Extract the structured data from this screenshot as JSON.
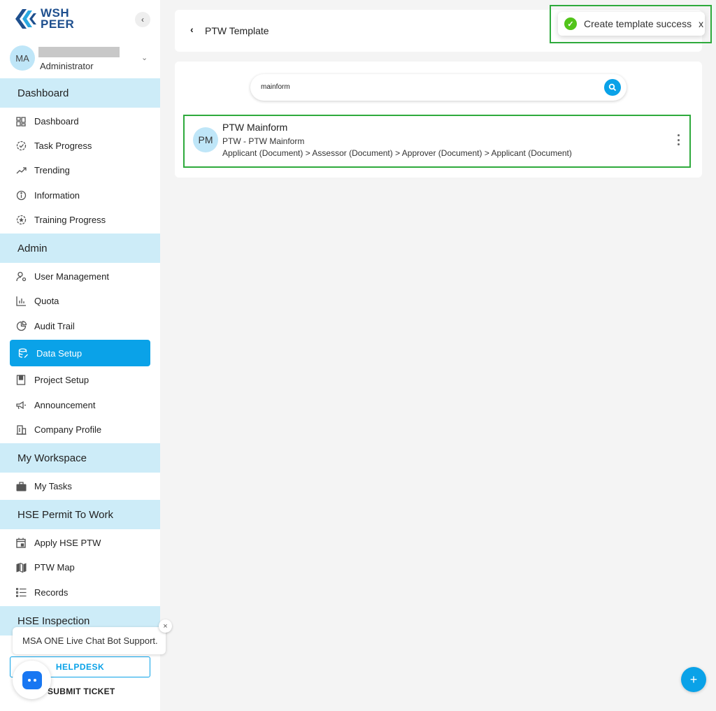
{
  "brand": {
    "line1": "WSH",
    "line2": "PEER",
    "color": "#1e4f8e"
  },
  "user": {
    "initials": "MA",
    "role": "Administrator"
  },
  "sidebar": {
    "sections": [
      {
        "title": "Dashboard",
        "items": [
          {
            "label": "Dashboard",
            "icon": "dashboard-grid-icon"
          },
          {
            "label": "Task Progress",
            "icon": "progress-circle-icon"
          },
          {
            "label": "Trending",
            "icon": "trending-icon"
          },
          {
            "label": "Information",
            "icon": "info-icon"
          },
          {
            "label": "Training Progress",
            "icon": "training-icon"
          }
        ]
      },
      {
        "title": "Admin",
        "items": [
          {
            "label": "User Management",
            "icon": "user-gear-icon"
          },
          {
            "label": "Quota",
            "icon": "bar-chart-icon"
          },
          {
            "label": "Audit Trail",
            "icon": "pie-chart-icon"
          },
          {
            "label": "Data Setup",
            "icon": "database-edit-icon",
            "active": true
          },
          {
            "label": "Project Setup",
            "icon": "book-icon"
          },
          {
            "label": "Announcement",
            "icon": "megaphone-icon"
          },
          {
            "label": "Company Profile",
            "icon": "building-icon"
          }
        ]
      },
      {
        "title": "My Workspace",
        "items": [
          {
            "label": "My Tasks",
            "icon": "briefcase-icon"
          }
        ]
      },
      {
        "title": "HSE Permit To Work",
        "items": [
          {
            "label": "Apply HSE PTW",
            "icon": "calendar-icon"
          },
          {
            "label": "PTW Map",
            "icon": "map-icon"
          },
          {
            "label": "Records",
            "icon": "list-icon"
          }
        ]
      },
      {
        "title": "HSE Inspection",
        "items": []
      }
    ]
  },
  "chat": {
    "tooltip": "MSA ONE Live Chat Bot Support.",
    "close": "×",
    "helpdesk_label": "HELPDESK",
    "submit_ticket_label": "SUBMIT TICKET"
  },
  "header": {
    "back": "‹",
    "title": "PTW Template"
  },
  "toast": {
    "message": "Create template success",
    "close": "x",
    "color": "#52c41a"
  },
  "search": {
    "value": "mainform"
  },
  "templates": [
    {
      "initials": "PM",
      "title": "PTW Mainform",
      "subtitle": "PTW - PTW Mainform",
      "flow": "Applicant (Document) > Assessor (Document) > Approver (Document) > Applicant (Document)"
    }
  ],
  "fab": {
    "label": "+"
  },
  "colors": {
    "accent": "#0aa2e8",
    "section_bg": "#cdecf8",
    "highlight": "#2eaa3c"
  }
}
